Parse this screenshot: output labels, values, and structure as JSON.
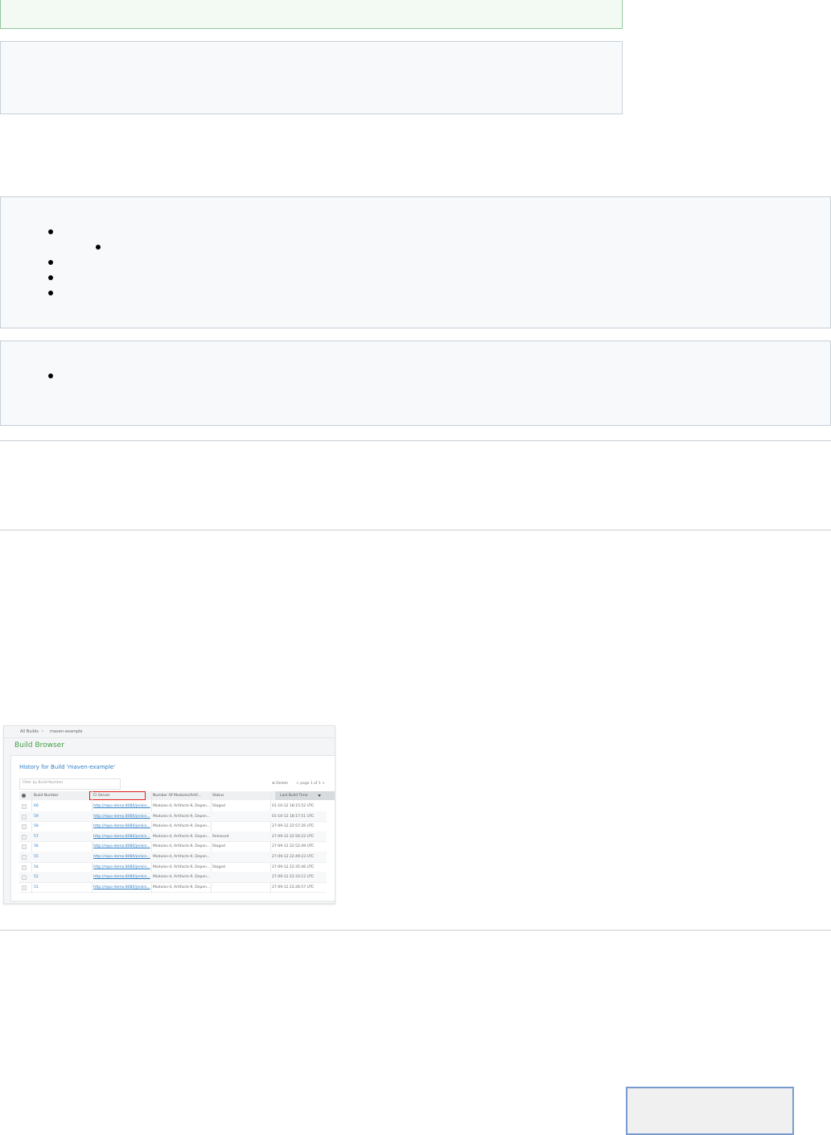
{
  "build_browser": {
    "breadcrumb": [
      "All Builds",
      "maven-example"
    ],
    "breadcrumb_separator": "›",
    "title": "Build Browser",
    "history_title": "History for Build 'maven-example'",
    "filter_placeholder": "Filter by Build Number",
    "delete_label": "Delete",
    "pagination": "< page 1 of 1 >",
    "columns": [
      "Build Number",
      "CI Server",
      "Number Of Modules/Artif...",
      "Status",
      "Last Build Time"
    ],
    "rows": [
      {
        "build": "60",
        "ci": "http://repo-demo:8080/jenkin...",
        "modules": "Modules-4, Artifacts-9, Depen...",
        "status": "Staged",
        "time": "01-10-12 18:15:52 UTC"
      },
      {
        "build": "59",
        "ci": "http://repo-demo:8080/jenkin...",
        "modules": "Modules-4, Artifacts-9, Depen...",
        "status": "",
        "time": "01-10-12 18:17:51 UTC"
      },
      {
        "build": "58",
        "ci": "http://repo-demo:8080/jenkin...",
        "modules": "Modules-4, Artifacts-9, Depen...",
        "status": "",
        "time": "27-09-12 22:57:26 UTC"
      },
      {
        "build": "57",
        "ci": "http://repo-demo:8080/jenkin...",
        "modules": "Modules-4, Artifacts-9, Depen...",
        "status": "Released",
        "time": "27-09-12 22:56:22 UTC"
      },
      {
        "build": "56",
        "ci": "http://repo-demo:8080/jenkin...",
        "modules": "Modules-4, Artifacts-9, Depen...",
        "status": "Staged",
        "time": "27-09-12 22:52:49 UTC"
      },
      {
        "build": "55",
        "ci": "http://repo-demo:8080/jenkin...",
        "modules": "Modules-4, Artifacts-9, Depen...",
        "status": "",
        "time": "27-09-12 22:49:23 UTC"
      },
      {
        "build": "54",
        "ci": "http://repo-demo:8080/jenkin...",
        "modules": "Modules-4, Artifacts-9, Depen...",
        "status": "Staged",
        "time": "27-09-12 22:35:46 UTC"
      },
      {
        "build": "52",
        "ci": "http://repo-demo:8080/jenkin...",
        "modules": "Modules-4, Artifacts-9, Depen...",
        "status": "",
        "time": "27-09-12 22:33:12 UTC"
      },
      {
        "build": "51",
        "ci": "http://repo-demo:8080/jenkin...",
        "modules": "Modules-4, Artifacts-9, Depen...",
        "status": "",
        "time": "27-09-12 22:26:57 UTC"
      }
    ]
  },
  "colors": {
    "success_panel_border": "#91c89c",
    "info_panel_border": "#c6d0da",
    "title_green": "#43a047",
    "link_blue": "#2d7cc4",
    "highlight_red": "#e02020",
    "bottom_box_border": "#7a9bd0"
  }
}
